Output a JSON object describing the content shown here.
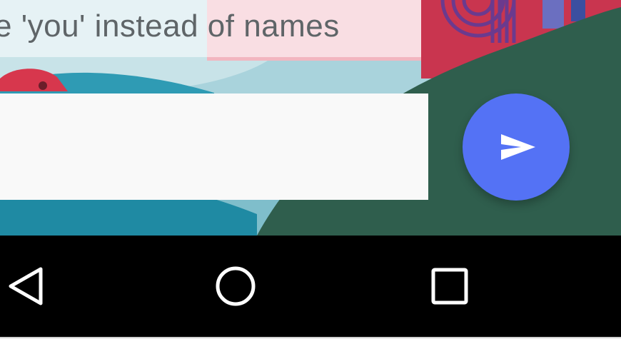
{
  "chat": {
    "hint_text": "e 'you' instead of names",
    "compose": {
      "value": "",
      "placeholder": ""
    },
    "send_button": {
      "icon": "send-icon",
      "color": "#5472f5"
    }
  },
  "wallpaper": {
    "colors": {
      "teal": "#7fbecb",
      "deep_teal": "#1f8aa3",
      "green": "#2f5e4d",
      "pink": "#f2b6c0",
      "crimson": "#c9354f",
      "purple": "#6b3a8e"
    }
  },
  "navigation_bar": {
    "background": "#000000",
    "buttons": [
      {
        "name": "back",
        "icon": "back-triangle-icon"
      },
      {
        "name": "home",
        "icon": "home-circle-icon"
      },
      {
        "name": "recents",
        "icon": "recents-square-icon"
      }
    ]
  }
}
